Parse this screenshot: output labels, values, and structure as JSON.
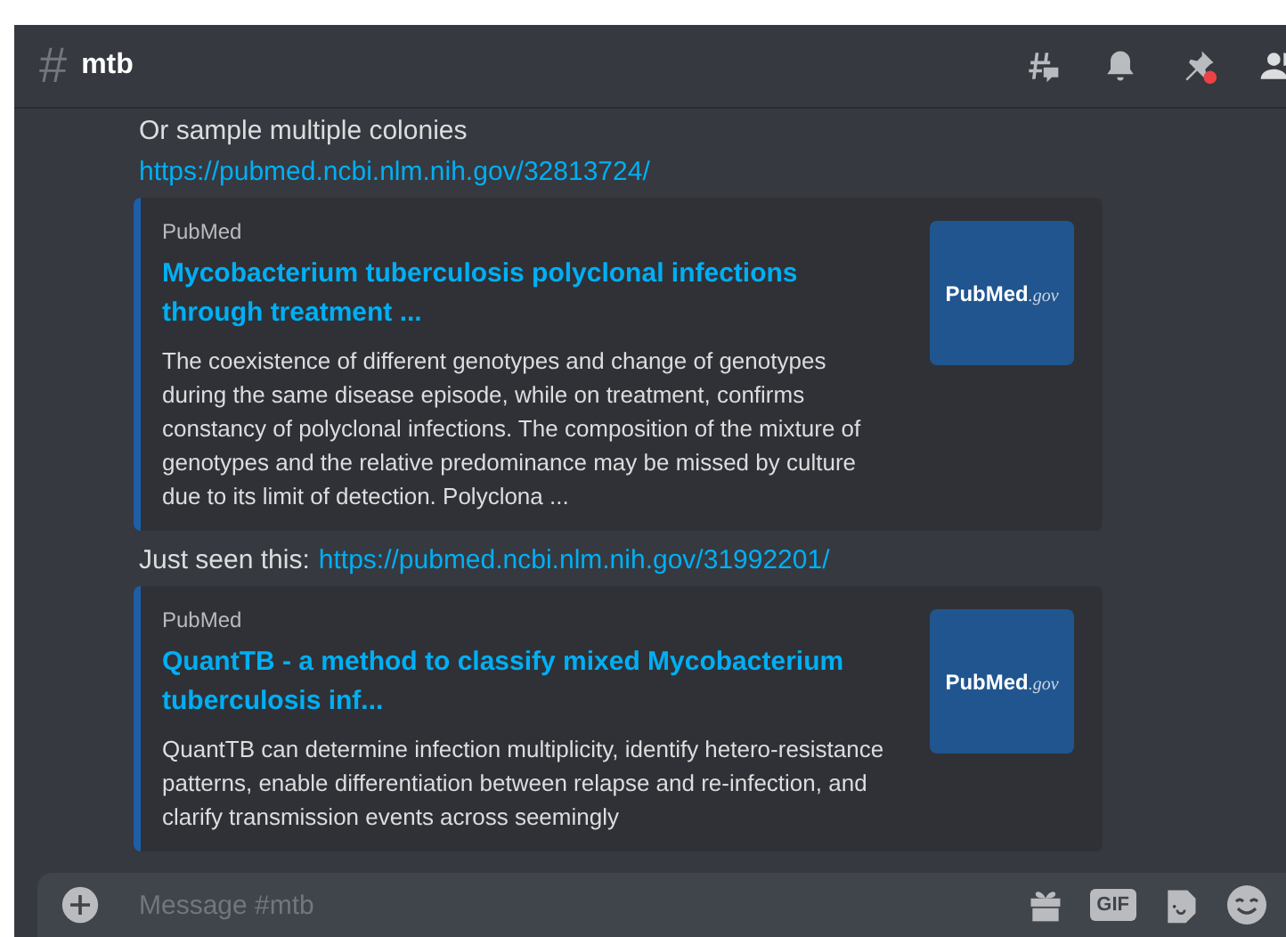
{
  "channel": {
    "icon": "#",
    "name": "mtb"
  },
  "messages": [
    {
      "text": "Or sample multiple colonies"
    },
    {
      "link": "https://pubmed.ncbi.nlm.nih.gov/32813724/",
      "embed": {
        "provider": "PubMed",
        "title": "Mycobacterium tuberculosis polyclonal infections through treatment ...",
        "description": "The coexistence of different genotypes and change of genotypes during the same disease episode, while on treatment, confirms constancy of polyclonal infections. The composition of the mixture of genotypes and the relative predominance may be missed by culture due to its limit of detection. Polyclona ...",
        "thumb_name": "PubMed",
        "thumb_suffix": ".gov"
      }
    },
    {
      "text": "Just seen this:",
      "link": "https://pubmed.ncbi.nlm.nih.gov/31992201/",
      "embed": {
        "provider": "PubMed",
        "title": "QuantTB - a method to classify mixed Mycobacterium tuberculosis inf...",
        "description": "QuantTB can determine infection multiplicity, identify hetero-resistance patterns, enable differentiation between relapse and re-infection, and clarify transmission events across seemingly",
        "thumb_name": "PubMed",
        "thumb_suffix": ".gov"
      }
    }
  ],
  "composer": {
    "placeholder": "Message #mtb",
    "gif_label": "GIF"
  },
  "pins_unread": true
}
